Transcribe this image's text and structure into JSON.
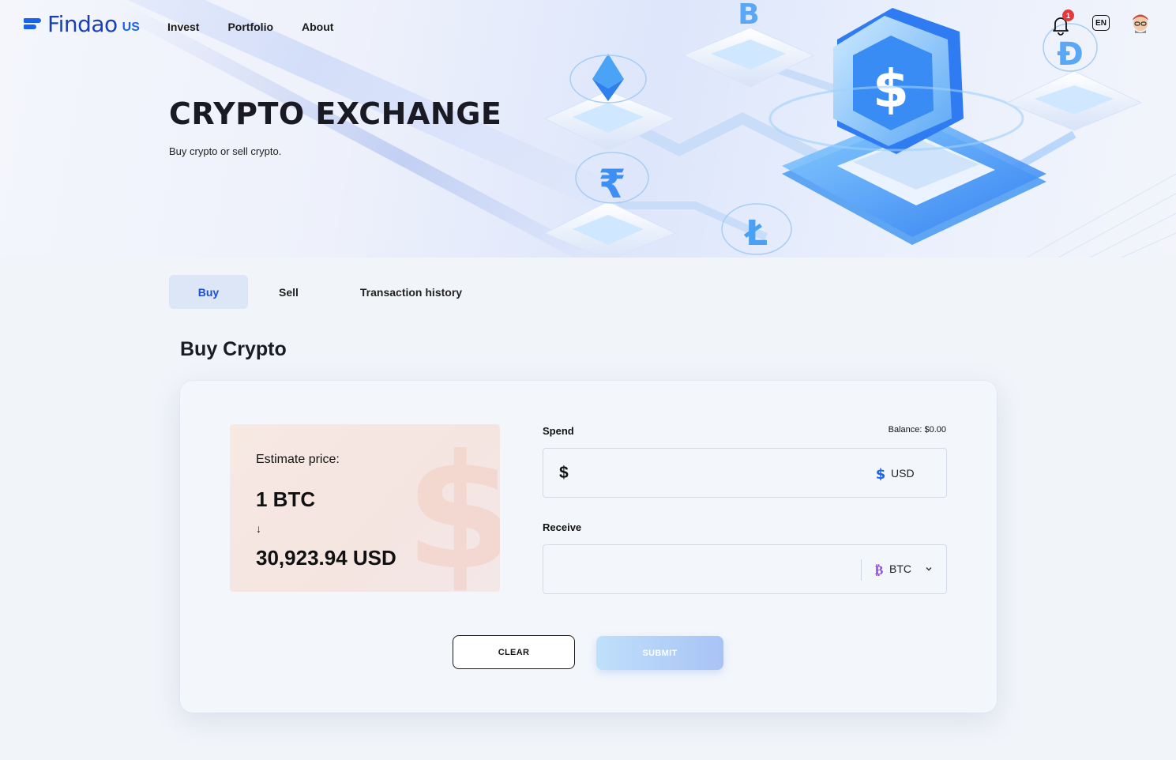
{
  "brand": {
    "name": "Findao",
    "region": "US"
  },
  "nav": {
    "links": [
      "Invest",
      "Portfolio",
      "About"
    ],
    "notification_count": "1",
    "language": "EN"
  },
  "hero": {
    "title": "CRYPTO EXCHANGE",
    "subtitle": "Buy crypto or sell crypto."
  },
  "tabs": [
    {
      "label": "Buy",
      "active": true
    },
    {
      "label": "Sell",
      "active": false
    },
    {
      "label": "Transaction history",
      "active": false
    }
  ],
  "section_title": "Buy Crypto",
  "estimate": {
    "label": "Estimate price:",
    "from": "1 BTC",
    "arrow": "↓",
    "to": "30,923.94 USD"
  },
  "spend": {
    "label": "Spend",
    "balance": "Balance: $0.00",
    "prefix": "$",
    "value": "",
    "currency": "USD",
    "icon": "dollar-icon"
  },
  "receive": {
    "label": "Receive",
    "value": "",
    "currency": "BTC",
    "icon": "bitcoin-icon"
  },
  "actions": {
    "clear": "CLEAR",
    "submit": "SUBMIT"
  },
  "colors": {
    "accent": "#1a64ee",
    "active_tab_bg": "#dde6f7",
    "badge": "#e5393b",
    "bitcoin": "#8a4dd8"
  }
}
